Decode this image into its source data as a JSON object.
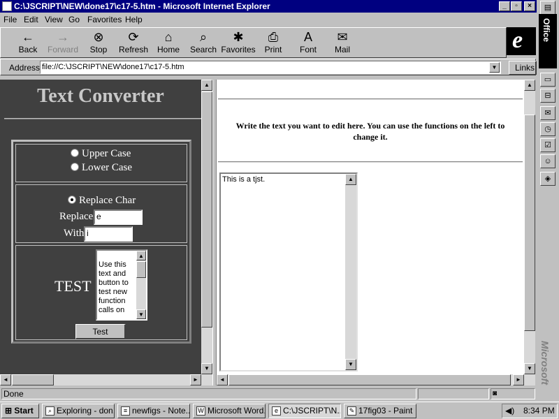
{
  "window": {
    "title": "C:\\JSCRIPT\\NEW\\done17\\c17-5.htm - Microsoft Internet Explorer",
    "minimize": "_",
    "maximize": "▫",
    "close": "×"
  },
  "menu": [
    "File",
    "Edit",
    "View",
    "Go",
    "Favorites",
    "Help"
  ],
  "toolbar": [
    {
      "label": "Back",
      "icon": "←"
    },
    {
      "label": "Forward",
      "icon": "→"
    },
    {
      "label": "Stop",
      "icon": "⊗"
    },
    {
      "label": "Refresh",
      "icon": "⟳"
    },
    {
      "label": "Home",
      "icon": "⌂"
    },
    {
      "label": "Search",
      "icon": "⌕"
    },
    {
      "label": "Favorites",
      "icon": "✱"
    },
    {
      "label": "Print",
      "icon": "⎙"
    },
    {
      "label": "Font",
      "icon": "A"
    },
    {
      "label": "Mail",
      "icon": "✉"
    }
  ],
  "brand": {
    "ie_logo": "e"
  },
  "address": {
    "label": "Address",
    "url": "file://C:\\JSCRIPT\\NEW\\done17\\c17-5.htm",
    "links": "Links"
  },
  "office": {
    "label": "Office",
    "microsoft": "Microsoft"
  },
  "left": {
    "title": "Text Converter",
    "upper_case": "Upper Case",
    "lower_case": "Lower Case",
    "replace_char": "Replace Char",
    "replace_label": "Replace",
    "replace_value": "e",
    "with_label": "With",
    "with_value": "i",
    "test_label": "TEST",
    "test_area_text": "Use this text and button to test new function calls on",
    "test_button": "Test"
  },
  "right": {
    "instructions": "Write the text you want to edit here. You can use the functions on the left to change it.",
    "edit_text": "This is a tjst."
  },
  "status": {
    "text": "Done"
  },
  "taskbar": {
    "start": "Start",
    "tasks": [
      {
        "label": "Exploring - don...",
        "icon": "⌕"
      },
      {
        "label": "newfigs - Note...",
        "icon": "≡"
      },
      {
        "label": "Microsoft Word...",
        "icon": "W"
      },
      {
        "label": "C:\\JSCRIPT\\N...",
        "icon": "e"
      },
      {
        "label": "17fig03 - Paint",
        "icon": "✎"
      }
    ],
    "clock": "8:34 PM"
  },
  "colors": {
    "titlebar": "#000080",
    "left_frame_bg": "#404040",
    "title_text": "#c8c8c8"
  }
}
